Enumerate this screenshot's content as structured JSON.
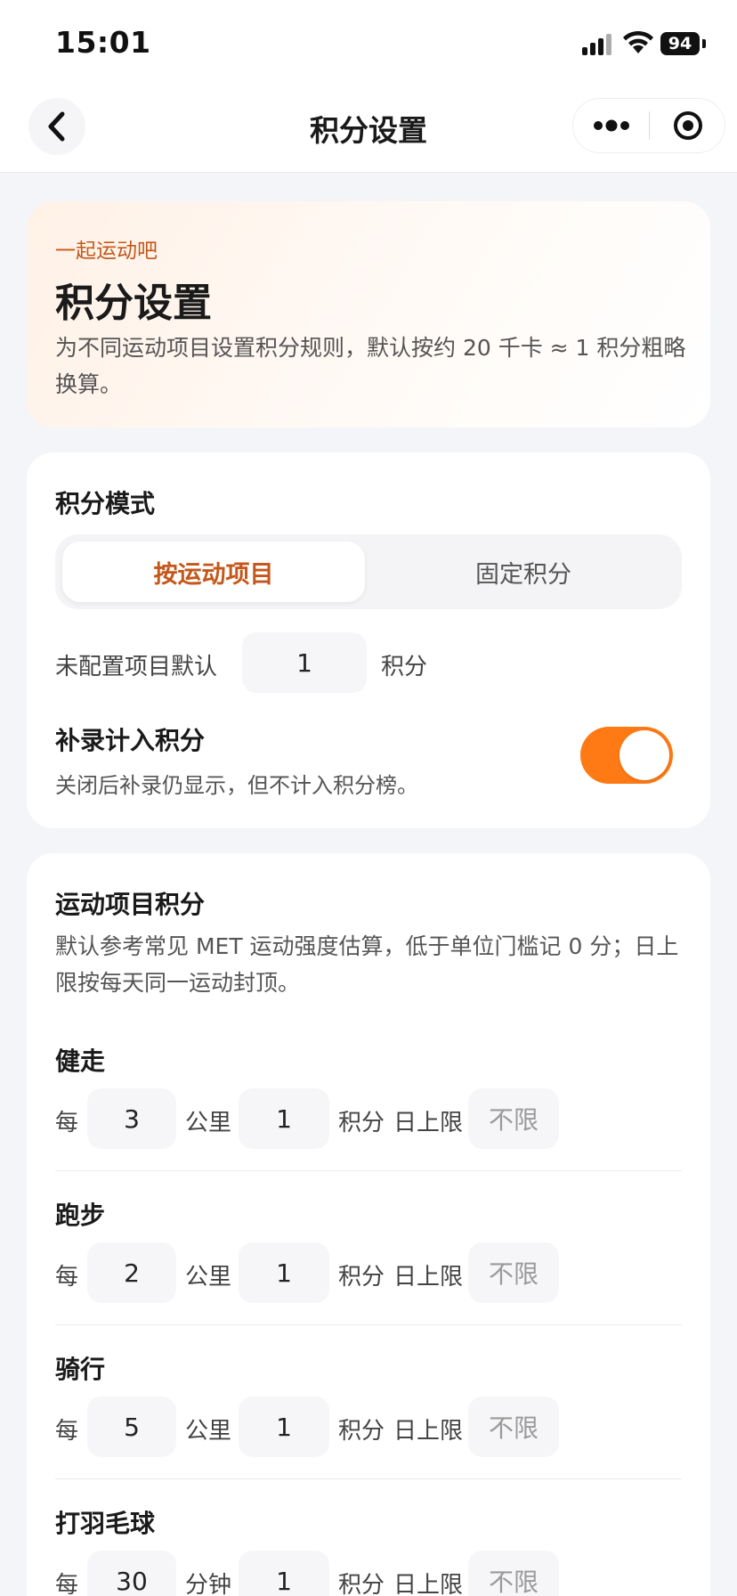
{
  "status": {
    "time": "15:01",
    "battery": "94"
  },
  "nav": {
    "title": "积分设置"
  },
  "hero": {
    "kicker": "一起运动吧",
    "title": "积分设置",
    "desc": "为不同运动项目设置积分规则，默认按约 20 千卡 ≈ 1 积分粗略换算。"
  },
  "mode": {
    "title": "积分模式",
    "options": [
      "按运动项目",
      "固定积分"
    ],
    "selected": "按运动项目",
    "default_label": "未配置项目默认",
    "default_value": "1",
    "default_unit": "积分",
    "makeup_title": "补录计入积分",
    "makeup_desc": "关闭后补录仍显示，但不计入积分榜。",
    "makeup_on": true
  },
  "sports": {
    "title": "运动项目积分",
    "desc": "默认参考常见 MET 运动强度估算，低于单位门槛记 0 分；日上限按每天同一运动封顶。",
    "per_label": "每",
    "points_label": "积分",
    "cap_label": "日上限",
    "cap_placeholder": "不限",
    "items": [
      {
        "name": "健走",
        "amount": "3",
        "unit": "公里",
        "points": "1"
      },
      {
        "name": "跑步",
        "amount": "2",
        "unit": "公里",
        "points": "1"
      },
      {
        "name": "骑行",
        "amount": "5",
        "unit": "公里",
        "points": "1"
      },
      {
        "name": "打羽毛球",
        "amount": "30",
        "unit": "分钟",
        "points": "1"
      }
    ]
  },
  "colors": {
    "accent": "#ff7a14",
    "accent_text": "#c4571b",
    "background": "#f4f5f8"
  }
}
